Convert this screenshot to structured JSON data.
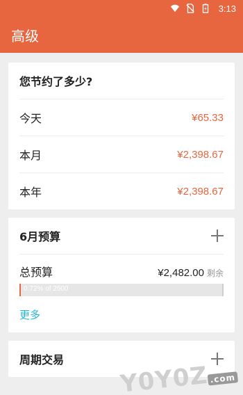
{
  "status_bar": {
    "time": "3:13"
  },
  "app_bar": {
    "title": "高级"
  },
  "savings": {
    "title": "您节约了多少?",
    "rows": [
      {
        "label": "今天",
        "amount": "¥65.33"
      },
      {
        "label": "本月",
        "amount": "¥2,398.67"
      },
      {
        "label": "本年",
        "amount": "¥2,398.67"
      }
    ]
  },
  "budget": {
    "title": "6月预算",
    "total_label": "总预算",
    "total_value": "¥2,482.00",
    "remain_label": "剩余",
    "progress_text": "0.72%  of  2500",
    "progress_percent": 0.72,
    "more_label": "更多"
  },
  "periodic": {
    "title": "周期交易"
  },
  "watermark": {
    "text": "Y0Y0Z",
    "suffix": ".com"
  },
  "colors": {
    "accent": "#e8663f",
    "link": "#29b6d8"
  }
}
